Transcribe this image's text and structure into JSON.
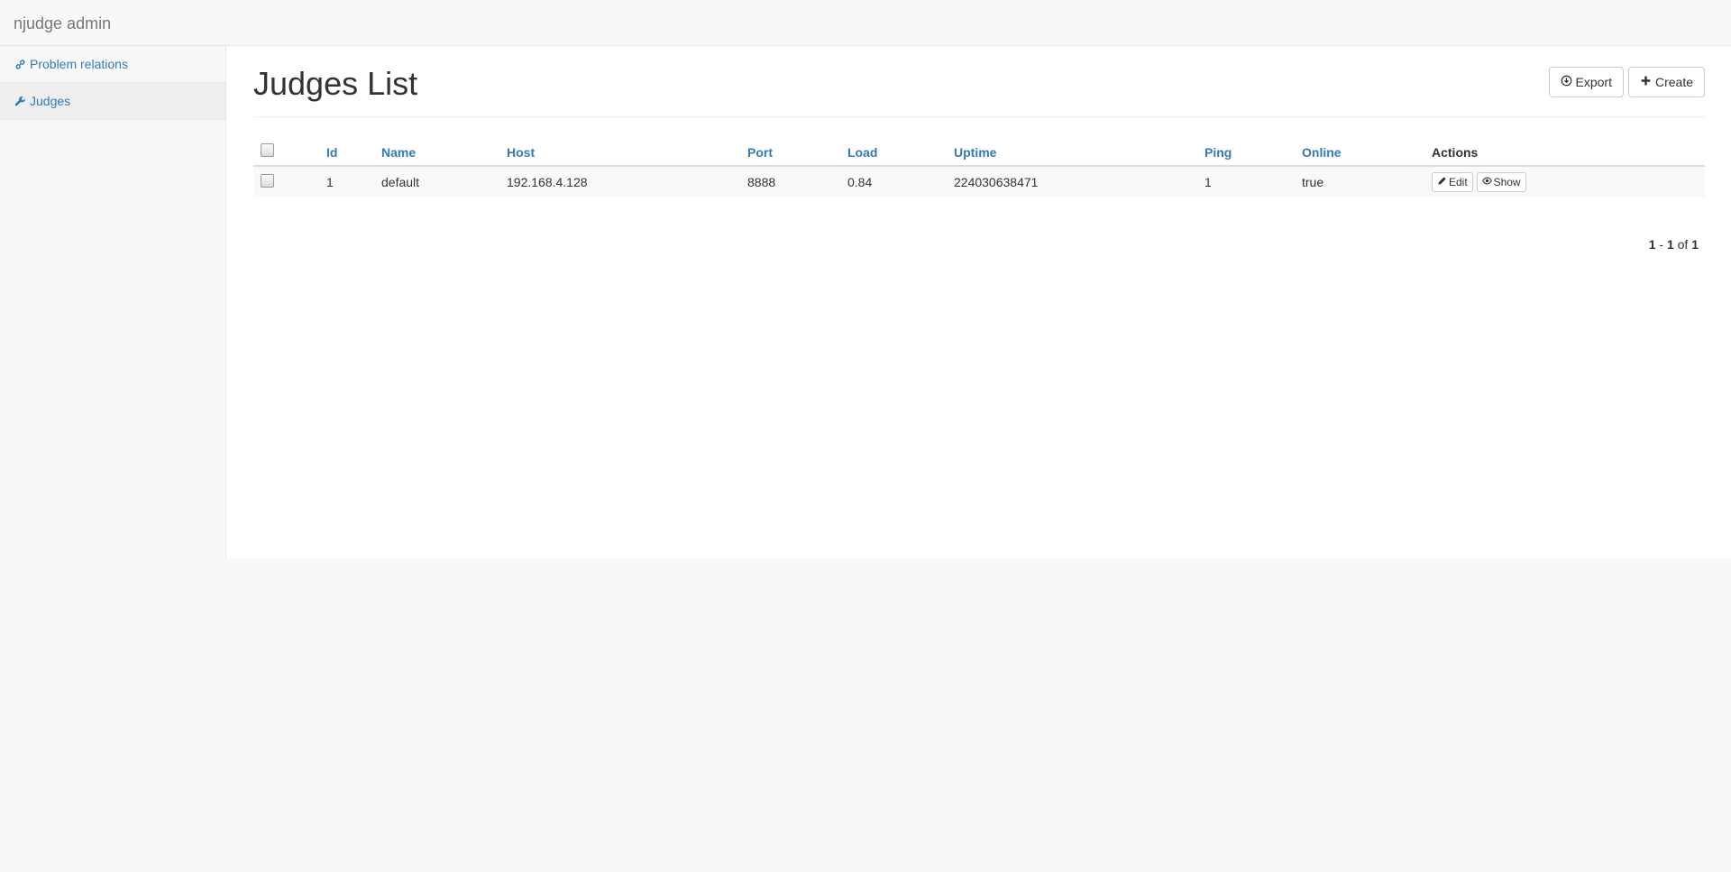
{
  "navbar": {
    "brand": "njudge admin"
  },
  "sidebar": {
    "items": [
      {
        "label": "Problem relations",
        "icon": "link-icon",
        "active": false
      },
      {
        "label": "Judges",
        "icon": "wrench-icon",
        "active": true
      }
    ]
  },
  "header": {
    "title": "Judges List",
    "export_label": "Export",
    "create_label": "Create"
  },
  "table": {
    "columns": [
      "Id",
      "Name",
      "Host",
      "Port",
      "Load",
      "Uptime",
      "Ping",
      "Online",
      "Actions"
    ],
    "rows": [
      {
        "id": "1",
        "name": "default",
        "host": "192.168.4.128",
        "port": "8888",
        "load": "0.84",
        "uptime": "224030638471",
        "ping": "1",
        "online": "true",
        "edit_label": "Edit",
        "show_label": "Show"
      }
    ]
  },
  "pagination": {
    "from": "1",
    "sep": "-",
    "to": "1",
    "of_label": "of",
    "total": "1"
  },
  "colors": {
    "link": "#337ab7",
    "border": "#e7e7e7",
    "background": "#f8f8f8"
  }
}
